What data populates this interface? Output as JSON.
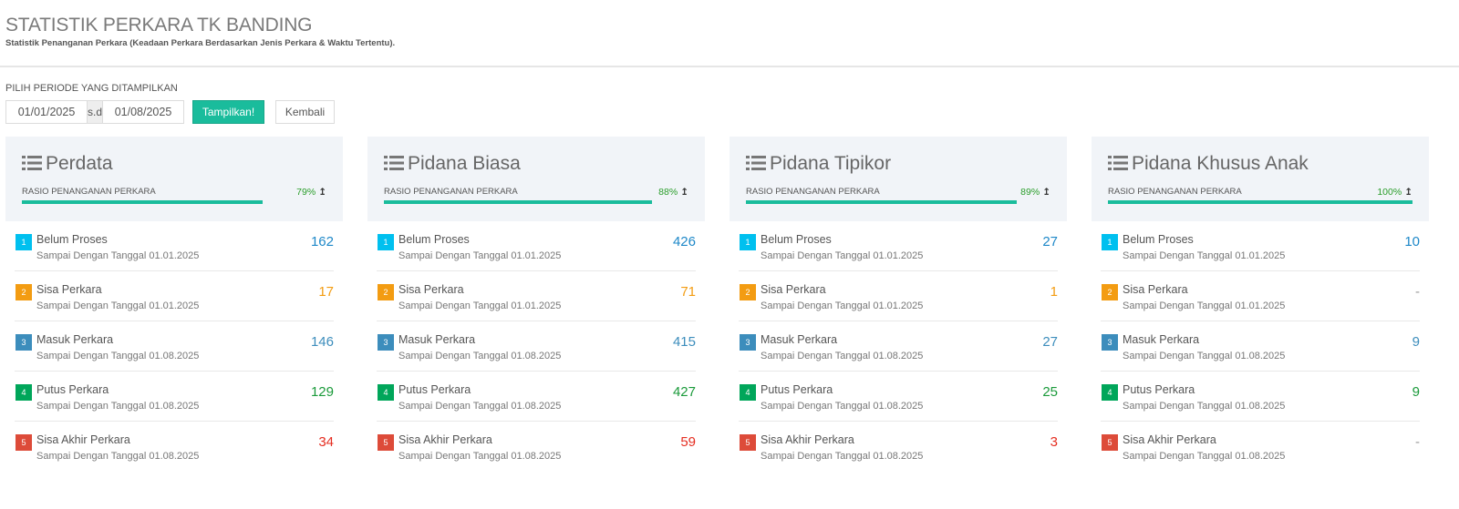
{
  "header": {
    "title": "STATISTIK PERKARA TK BANDING",
    "subtitle": "Statistik Penanganan Perkara (Keadaan Perkara Berdasarkan Jenis Perkara & Waktu Tertentu)."
  },
  "period": {
    "label": "PILIH PERIODE YANG DITAMPILKAN",
    "start": "01/01/2025",
    "separator": "s.d",
    "end": "01/08/2025",
    "show_label": "Tampilkan!",
    "back_label": "Kembali"
  },
  "icons": {
    "panel": "list-icon",
    "ratio": "arrow-up-icon"
  },
  "colors": {
    "accent": "#1abc9c",
    "badge1": "#00c0ef",
    "badge2": "#f39c12",
    "badge3": "#3c8dbc",
    "badge4": "#00a65a",
    "badge5": "#dd4b39"
  },
  "panels": [
    {
      "title": "Perdata",
      "ratio_label": "RASIO PENANGANAN PERKARA",
      "ratio_pct": "79%",
      "ratio": 0.79,
      "rows": [
        {
          "num": "1",
          "title": "Belum Proses",
          "sub": "Sampai Dengan Tanggal 01.01.2025",
          "value": "162"
        },
        {
          "num": "2",
          "title": "Sisa Perkara",
          "sub": "Sampai Dengan Tanggal 01.01.2025",
          "value": "17"
        },
        {
          "num": "3",
          "title": "Masuk Perkara",
          "sub": "Sampai Dengan Tanggal 01.08.2025",
          "value": "146"
        },
        {
          "num": "4",
          "title": "Putus Perkara",
          "sub": "Sampai Dengan Tanggal 01.08.2025",
          "value": "129"
        },
        {
          "num": "5",
          "title": "Sisa Akhir Perkara",
          "sub": "Sampai Dengan Tanggal 01.08.2025",
          "value": "34"
        }
      ]
    },
    {
      "title": "Pidana Biasa",
      "ratio_label": "RASIO PENANGANAN PERKARA",
      "ratio_pct": "88%",
      "ratio": 0.88,
      "rows": [
        {
          "num": "1",
          "title": "Belum Proses",
          "sub": "Sampai Dengan Tanggal 01.01.2025",
          "value": "426"
        },
        {
          "num": "2",
          "title": "Sisa Perkara",
          "sub": "Sampai Dengan Tanggal 01.01.2025",
          "value": "71"
        },
        {
          "num": "3",
          "title": "Masuk Perkara",
          "sub": "Sampai Dengan Tanggal 01.08.2025",
          "value": "415"
        },
        {
          "num": "4",
          "title": "Putus Perkara",
          "sub": "Sampai Dengan Tanggal 01.08.2025",
          "value": "427"
        },
        {
          "num": "5",
          "title": "Sisa Akhir Perkara",
          "sub": "Sampai Dengan Tanggal 01.08.2025",
          "value": "59"
        }
      ]
    },
    {
      "title": "Pidana Tipikor",
      "ratio_label": "RASIO PENANGANAN PERKARA",
      "ratio_pct": "89%",
      "ratio": 0.89,
      "rows": [
        {
          "num": "1",
          "title": "Belum Proses",
          "sub": "Sampai Dengan Tanggal 01.01.2025",
          "value": "27"
        },
        {
          "num": "2",
          "title": "Sisa Perkara",
          "sub": "Sampai Dengan Tanggal 01.01.2025",
          "value": "1"
        },
        {
          "num": "3",
          "title": "Masuk Perkara",
          "sub": "Sampai Dengan Tanggal 01.08.2025",
          "value": "27"
        },
        {
          "num": "4",
          "title": "Putus Perkara",
          "sub": "Sampai Dengan Tanggal 01.08.2025",
          "value": "25"
        },
        {
          "num": "5",
          "title": "Sisa Akhir Perkara",
          "sub": "Sampai Dengan Tanggal 01.08.2025",
          "value": "3"
        }
      ]
    },
    {
      "title": "Pidana Khusus Anak",
      "ratio_label": "RASIO PENANGANAN PERKARA",
      "ratio_pct": "100%",
      "ratio": 1.0,
      "rows": [
        {
          "num": "1",
          "title": "Belum Proses",
          "sub": "Sampai Dengan Tanggal 01.01.2025",
          "value": "10"
        },
        {
          "num": "2",
          "title": "Sisa Perkara",
          "sub": "Sampai Dengan Tanggal 01.01.2025",
          "value": "-"
        },
        {
          "num": "3",
          "title": "Masuk Perkara",
          "sub": "Sampai Dengan Tanggal 01.08.2025",
          "value": "9"
        },
        {
          "num": "4",
          "title": "Putus Perkara",
          "sub": "Sampai Dengan Tanggal 01.08.2025",
          "value": "9"
        },
        {
          "num": "5",
          "title": "Sisa Akhir Perkara",
          "sub": "Sampai Dengan Tanggal 01.08.2025",
          "value": "-"
        }
      ]
    }
  ]
}
